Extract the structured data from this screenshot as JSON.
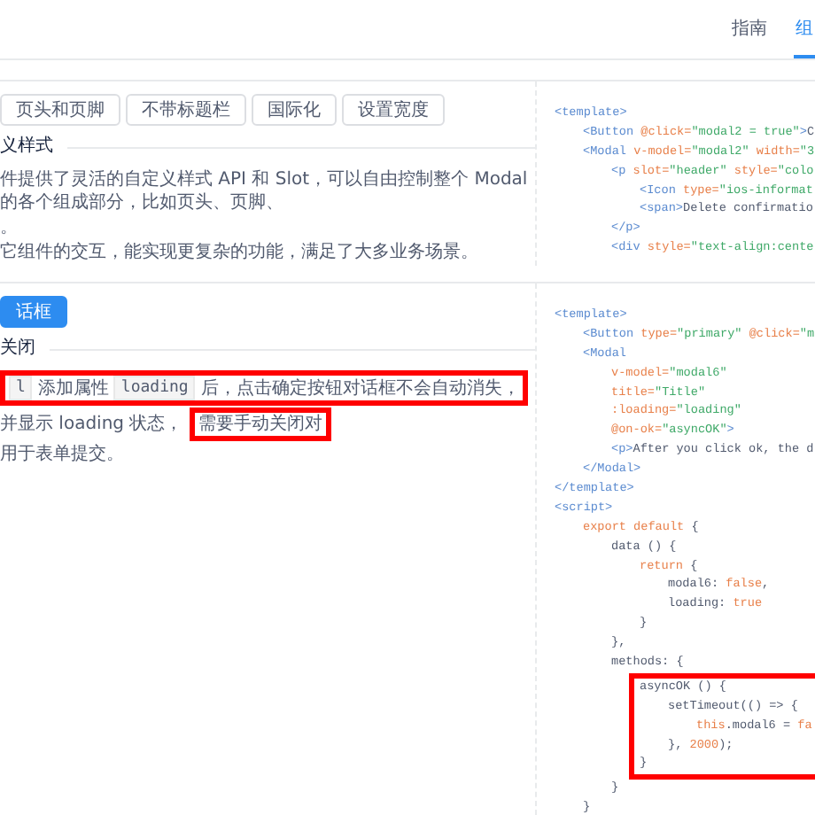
{
  "nav": {
    "tabs": [
      {
        "label": "指南",
        "selected": false
      },
      {
        "label": "组",
        "selected": true
      }
    ]
  },
  "sections": [
    {
      "buttons": [
        {
          "label": "页头和页脚",
          "kind": "default"
        },
        {
          "label": "不带标题栏",
          "kind": "default"
        },
        {
          "label": "国际化",
          "kind": "default"
        },
        {
          "label": "设置宽度",
          "kind": "default"
        }
      ],
      "title": "义样式",
      "description": [
        [
          {
            "highlighted": false,
            "parts": [
              {
                "text": "件提供了灵活的自定义样式 API 和 Slot，可以自由控制整个 Modal 的各个组成部分，比如页头、页脚、",
                "code": false
              }
            ]
          }
        ],
        [
          {
            "highlighted": false,
            "parts": [
              {
                "text": "。",
                "code": false
              }
            ]
          }
        ],
        [
          {
            "highlighted": false,
            "parts": [
              {
                "text": "它组件的交互，能实现更复杂的功能，满足了大多业务场景。",
                "code": false
              }
            ]
          }
        ]
      ],
      "code": [
        {
          "tokens": [
            {
              "kind": "tag",
              "text": "<template>"
            }
          ],
          "children": [
            {
              "tokens": [
                {
                  "kind": "tag",
                  "text": "<Button "
                },
                {
                  "kind": "attr",
                  "text": "@click="
                },
                {
                  "kind": "str",
                  "text": "\"modal2 = true\""
                },
                {
                  "kind": "tag",
                  "text": ">"
                },
                {
                  "kind": "plain",
                  "text": "C"
                }
              ]
            },
            {
              "tokens": [
                {
                  "kind": "tag",
                  "text": "<Modal "
                },
                {
                  "kind": "attr",
                  "text": "v-model="
                },
                {
                  "kind": "str",
                  "text": "\"modal2\""
                },
                {
                  "kind": "attr",
                  "text": " width="
                },
                {
                  "kind": "str",
                  "text": "\"3"
                }
              ],
              "children": [
                {
                  "tokens": [
                    {
                      "kind": "tag",
                      "text": "<p "
                    },
                    {
                      "kind": "attr",
                      "text": "slot="
                    },
                    {
                      "kind": "str",
                      "text": "\"header\""
                    },
                    {
                      "kind": "attr",
                      "text": " style="
                    },
                    {
                      "kind": "str",
                      "text": "\"colo"
                    }
                  ],
                  "children": [
                    {
                      "tokens": [
                        {
                          "kind": "tag",
                          "text": "<Icon "
                        },
                        {
                          "kind": "attr",
                          "text": "type="
                        },
                        {
                          "kind": "str",
                          "text": "\"ios-informat"
                        }
                      ]
                    },
                    {
                      "tokens": [
                        {
                          "kind": "tag",
                          "text": "<span>"
                        },
                        {
                          "kind": "plain",
                          "text": "Delete confirmatio"
                        }
                      ]
                    }
                  ]
                },
                {
                  "tokens": [
                    {
                      "kind": "tag",
                      "text": "</p>"
                    }
                  ]
                },
                {
                  "tokens": [
                    {
                      "kind": "tag",
                      "text": "<div "
                    },
                    {
                      "kind": "attr",
                      "text": "style="
                    },
                    {
                      "kind": "str",
                      "text": "\"text-align:cente"
                    }
                  ]
                }
              ]
            }
          ]
        }
      ]
    },
    {
      "buttons": [
        {
          "label": "话框",
          "kind": "primary"
        }
      ],
      "title": "关闭",
      "description": [
        [
          {
            "highlighted": true,
            "parts": [
              {
                "text": "l",
                "code": true
              },
              {
                "text": "添加属性",
                "code": false
              },
              {
                "text": "loading",
                "code": true
              },
              {
                "text": "后，点击确定按钮对话框不会自动消失，",
                "code": false
              }
            ]
          }
        ],
        [
          {
            "highlighted": false,
            "parts": [
              {
                "text": "并显示 loading 状态，",
                "code": false
              }
            ]
          },
          {
            "highlighted": true,
            "parts": [
              {
                "text": "需要手动关闭对",
                "code": false
              }
            ]
          }
        ],
        [
          {
            "highlighted": false,
            "parts": [
              {
                "text": "用于表单提交。",
                "code": false
              }
            ]
          }
        ]
      ],
      "code": [
        {
          "tokens": [
            {
              "kind": "tag",
              "text": "<template>"
            }
          ],
          "children": [
            {
              "tokens": [
                {
                  "kind": "tag",
                  "text": "<Button "
                },
                {
                  "kind": "attr",
                  "text": "type="
                },
                {
                  "kind": "str",
                  "text": "\"primary\""
                },
                {
                  "kind": "attr",
                  "text": " @click="
                },
                {
                  "kind": "str",
                  "text": "\"m"
                }
              ]
            },
            {
              "tokens": [
                {
                  "kind": "tag",
                  "text": "<Modal"
                }
              ],
              "children": [
                {
                  "tokens": [
                    {
                      "kind": "attr",
                      "text": "v-model="
                    },
                    {
                      "kind": "str",
                      "text": "\"modal6\""
                    }
                  ]
                },
                {
                  "tokens": [
                    {
                      "kind": "attr",
                      "text": "title="
                    },
                    {
                      "kind": "str",
                      "text": "\"Title\""
                    }
                  ]
                },
                {
                  "tokens": [
                    {
                      "kind": "attr",
                      "text": ":loading="
                    },
                    {
                      "kind": "str",
                      "text": "\"loading\""
                    }
                  ]
                },
                {
                  "tokens": [
                    {
                      "kind": "attr",
                      "text": "@on-ok="
                    },
                    {
                      "kind": "str",
                      "text": "\"asyncOK\""
                    },
                    {
                      "kind": "tag",
                      "text": ">"
                    }
                  ]
                },
                {
                  "tokens": [
                    {
                      "kind": "tag",
                      "text": "<p>"
                    },
                    {
                      "kind": "plain",
                      "text": "After you click ok, the d"
                    }
                  ]
                }
              ]
            },
            {
              "tokens": [
                {
                  "kind": "tag",
                  "text": "</Modal>"
                }
              ]
            }
          ]
        },
        {
          "tokens": [
            {
              "kind": "tag",
              "text": "</template>"
            }
          ]
        },
        {
          "tokens": [
            {
              "kind": "tag",
              "text": "<script>"
            }
          ],
          "children": [
            {
              "tokens": [
                {
                  "kind": "kw",
                  "text": "export default "
                },
                {
                  "kind": "plain",
                  "text": "{"
                }
              ],
              "children": [
                {
                  "tokens": [
                    {
                      "kind": "plain",
                      "text": "data () {"
                    }
                  ],
                  "children": [
                    {
                      "tokens": [
                        {
                          "kind": "kw",
                          "text": "return "
                        },
                        {
                          "kind": "plain",
                          "text": "{"
                        }
                      ],
                      "children": [
                        {
                          "tokens": [
                            {
                              "kind": "plain",
                              "text": "modal6: "
                            },
                            {
                              "kind": "kw",
                              "text": "false"
                            },
                            {
                              "kind": "plain",
                              "text": ","
                            }
                          ]
                        },
                        {
                          "tokens": [
                            {
                              "kind": "plain",
                              "text": "loading: "
                            },
                            {
                              "kind": "kw",
                              "text": "true"
                            }
                          ]
                        }
                      ]
                    },
                    {
                      "tokens": [
                        {
                          "kind": "plain",
                          "text": "}"
                        }
                      ]
                    }
                  ]
                },
                {
                  "tokens": [
                    {
                      "kind": "plain",
                      "text": "},"
                    }
                  ]
                },
                {
                  "tokens": [
                    {
                      "kind": "plain",
                      "text": "methods: {"
                    }
                  ],
                  "children": [
                    {
                      "boxed": true,
                      "tokens": [
                        {
                          "kind": "plain",
                          "text": "asyncOK () {"
                        }
                      ],
                      "children": [
                        {
                          "tokens": [
                            {
                              "kind": "plain",
                              "text": "setTimeout(() => {"
                            }
                          ],
                          "children": [
                            {
                              "tokens": [
                                {
                                  "kind": "kw",
                                  "text": "this"
                                },
                                {
                                  "kind": "plain",
                                  "text": ".modal6 = "
                                },
                                {
                                  "kind": "kw",
                                  "text": "fa"
                                }
                              ]
                            }
                          ]
                        },
                        {
                          "tokens": [
                            {
                              "kind": "plain",
                              "text": "}, "
                            },
                            {
                              "kind": "kw",
                              "text": "2000"
                            },
                            {
                              "kind": "plain",
                              "text": ");"
                            }
                          ]
                        }
                      ]
                    },
                    {
                      "boxed": true,
                      "tokens": [
                        {
                          "kind": "plain",
                          "text": "}"
                        }
                      ]
                    }
                  ]
                },
                {
                  "tokens": [
                    {
                      "kind": "plain",
                      "text": "}"
                    }
                  ]
                }
              ]
            },
            {
              "tokens": [
                {
                  "kind": "plain",
                  "text": "}"
                }
              ]
            }
          ]
        }
      ]
    }
  ]
}
